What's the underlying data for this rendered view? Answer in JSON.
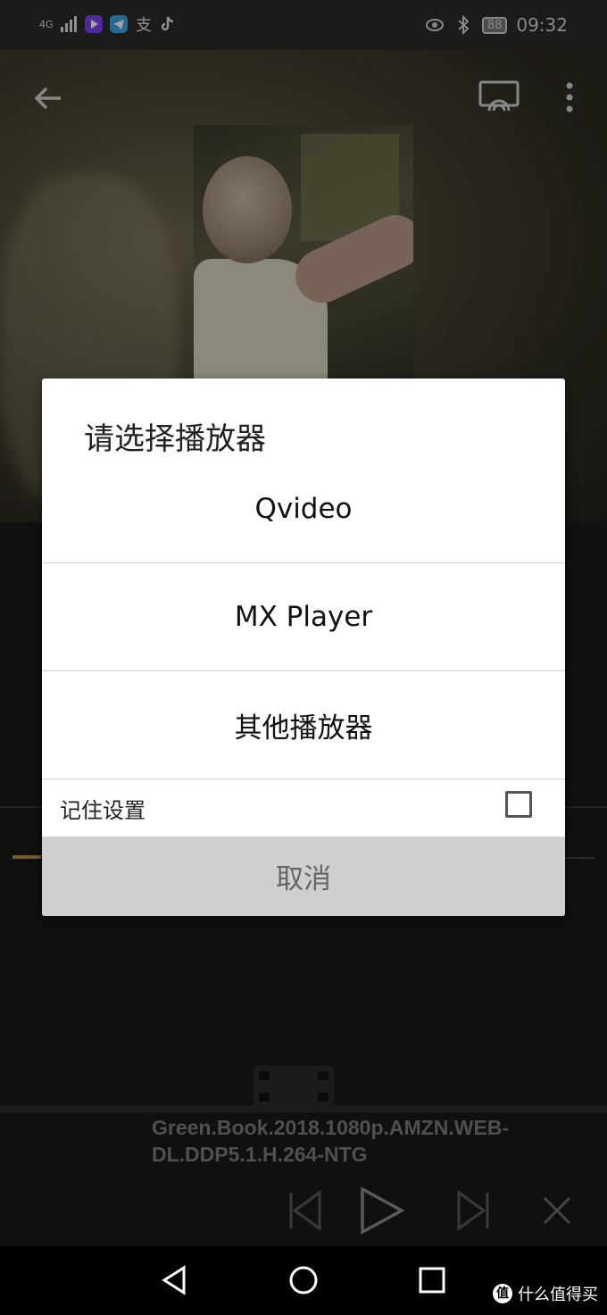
{
  "status_bar": {
    "network": "4G",
    "battery": "88",
    "time": "09:32"
  },
  "video_top_bar": {
    "back_icon": "arrow-left-icon",
    "cast_icon": "cast-icon",
    "more_icon": "more-vert-icon"
  },
  "dialog": {
    "title": "请选择播放器",
    "options": [
      "Qvideo",
      "MX Player",
      "其他播放器"
    ],
    "remember_label": "记住设置",
    "remember_checked": false,
    "cancel_label": "取消"
  },
  "player": {
    "file_name": "Green.Book.2018.1080p.AMZN.WEB-DL.DDP5.1.H.264-NTG"
  },
  "watermark": {
    "logo": "值",
    "text": "什么值得买"
  },
  "colors": {
    "accent_progress": "#b38a46",
    "dialog_bg": "#ffffff",
    "cancel_bg": "#cfcfcf"
  }
}
